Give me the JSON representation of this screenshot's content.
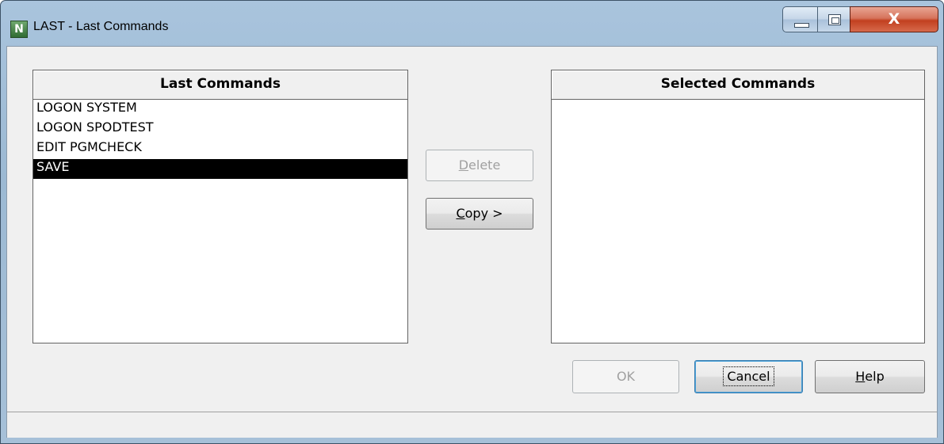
{
  "window": {
    "title": "LAST - Last Commands",
    "app_icon_letter": "N"
  },
  "caption_buttons": {
    "minimize": "minimize",
    "maximize": "maximize",
    "close": "X"
  },
  "last_commands": {
    "header": "Last Commands",
    "items": [
      "LOGON SYSTEM",
      "LOGON SPODTEST",
      "EDIT PGMCHECK",
      "SAVE"
    ],
    "selected_index": 3
  },
  "selected_commands": {
    "header": "Selected Commands",
    "items": []
  },
  "buttons": {
    "delete": {
      "mnemonic": "D",
      "rest": "elete",
      "enabled": false
    },
    "copy": {
      "mnemonic": "C",
      "rest": "opy >",
      "enabled": true
    },
    "ok": {
      "label": "OK",
      "enabled": false
    },
    "cancel": {
      "label": "Cancel",
      "enabled": true,
      "default": true
    },
    "help": {
      "mnemonic": "H",
      "rest": "elp",
      "enabled": true
    }
  },
  "colors": {
    "selection_bg": "#000000",
    "selection_fg": "#ffffff"
  }
}
